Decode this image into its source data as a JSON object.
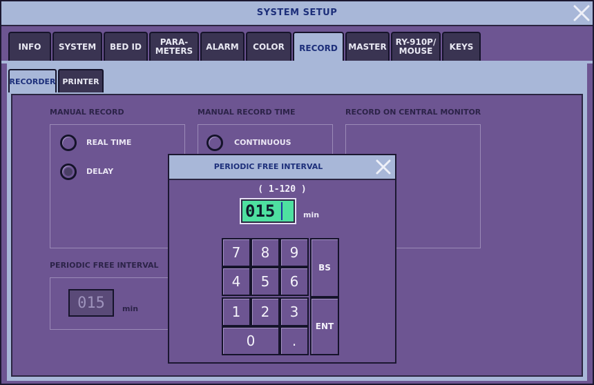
{
  "window": {
    "title": "SYSTEM SETUP"
  },
  "tabs": [
    {
      "label": "INFO"
    },
    {
      "label": "SYSTEM"
    },
    {
      "label": "BED ID"
    },
    {
      "label": "PARA-\nMETERS"
    },
    {
      "label": "ALARM"
    },
    {
      "label": "COLOR"
    },
    {
      "label": "RECORD",
      "active": true
    },
    {
      "label": "MASTER"
    },
    {
      "label": "RY-910P/\nMOUSE"
    },
    {
      "label": "KEYS"
    }
  ],
  "subtabs": [
    {
      "label": "RECORDER",
      "active": true
    },
    {
      "label": "PRINTER"
    }
  ],
  "manual_record": {
    "heading": "MANUAL RECORD",
    "options": [
      {
        "label": "REAL TIME",
        "selected": false
      },
      {
        "label": "DELAY",
        "selected": true
      }
    ]
  },
  "manual_record_time": {
    "heading": "MANUAL RECORD TIME",
    "options": [
      {
        "label": "CONTINUOUS",
        "selected": false
      }
    ]
  },
  "central_monitor": {
    "heading": "RECORD ON CENTRAL MONITOR"
  },
  "periodic_interval": {
    "heading": "PERIODIC FREE INTERVAL",
    "value": "015",
    "unit": "min"
  },
  "dialog": {
    "title": "PERIODIC FREE INTERVAL",
    "range": "( 1-120 )",
    "input_value": "015",
    "unit": "min",
    "keys": {
      "k7": "7",
      "k8": "8",
      "k9": "9",
      "bs": "BS",
      "k4": "4",
      "k5": "5",
      "k6": "6",
      "k1": "1",
      "k2": "2",
      "k3": "3",
      "ent": "ENT",
      "k0": "0",
      "dot": "."
    }
  },
  "colors": {
    "background": "#6d5592",
    "titlebar": "#a8b7d8",
    "title_text": "#1d2f7a",
    "input_highlight": "#4ee0a0"
  },
  "icons": {
    "close": "close-x-icon"
  }
}
